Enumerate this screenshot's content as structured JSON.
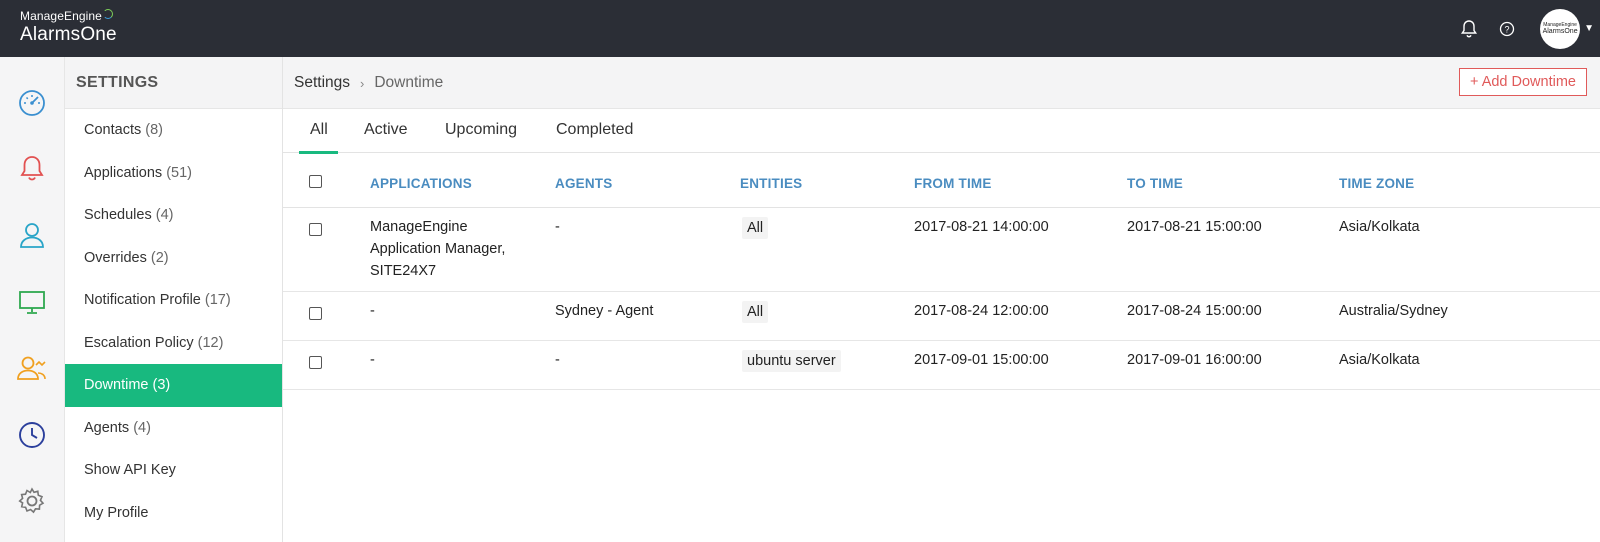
{
  "header": {
    "brand_top": "ManageEngine",
    "brand_main": "AlarmsOne",
    "avatar_top": "ManageEngine",
    "avatar_main": "AlarmsOne",
    "icons": [
      "bell-icon",
      "help-icon",
      "avatar",
      "caret-down-icon"
    ]
  },
  "rail": {
    "icons": [
      "dashboard-gauge-icon",
      "alarms-bell-icon",
      "users-icon",
      "monitor-icon",
      "groups-icon",
      "clock-icon",
      "settings-gear-icon"
    ],
    "colors": [
      "#3a8fd0",
      "#e25151",
      "#2aa5c8",
      "#2fa84f",
      "#f0a020",
      "#2b3f9c",
      "#777777"
    ]
  },
  "settings": {
    "heading": "SETTINGS",
    "items": [
      {
        "label": "Contacts",
        "count": "(8)"
      },
      {
        "label": "Applications",
        "count": "(51)"
      },
      {
        "label": "Schedules",
        "count": "(4)"
      },
      {
        "label": "Overrides",
        "count": "(2)"
      },
      {
        "label": "Notification Profile",
        "count": "(17)"
      },
      {
        "label": "Escalation Policy",
        "count": "(12)"
      },
      {
        "label": "Downtime",
        "count": "(3)"
      },
      {
        "label": "Agents",
        "count": "(4)"
      },
      {
        "label": "Show API Key",
        "count": ""
      },
      {
        "label": "My Profile",
        "count": ""
      }
    ],
    "active_index": 6
  },
  "breadcrumb": {
    "root": "Settings",
    "separator": "›",
    "current": "Downtime"
  },
  "add_button": "+ Add Downtime",
  "tabs": [
    "All",
    "Active",
    "Upcoming",
    "Completed"
  ],
  "active_tab": "All",
  "table": {
    "columns": [
      "APPLICATIONS",
      "AGENTS",
      "ENTITIES",
      "FROM TIME",
      "TO TIME",
      "TIME ZONE"
    ],
    "rows": [
      {
        "applications": "ManageEngine Application Manager, SITE24X7",
        "agents": "-",
        "entities": "All",
        "from": "2017-08-21 14:00:00",
        "to": "2017-08-21 15:00:00",
        "tz": "Asia/Kolkata"
      },
      {
        "applications": "-",
        "agents": "Sydney - Agent",
        "entities": "All",
        "from": "2017-08-24 12:00:00",
        "to": "2017-08-24 15:00:00",
        "tz": "Australia/Sydney"
      },
      {
        "applications": "-",
        "agents": "-",
        "entities": "ubuntu server",
        "from": "2017-09-01 15:00:00",
        "to": "2017-09-01 16:00:00",
        "tz": "Asia/Kolkata"
      }
    ]
  },
  "colors": {
    "accent_green": "#18b97f",
    "header_dark": "#2b2e36",
    "column_blue": "#4a8cc0",
    "add_red": "#e05a5a"
  }
}
